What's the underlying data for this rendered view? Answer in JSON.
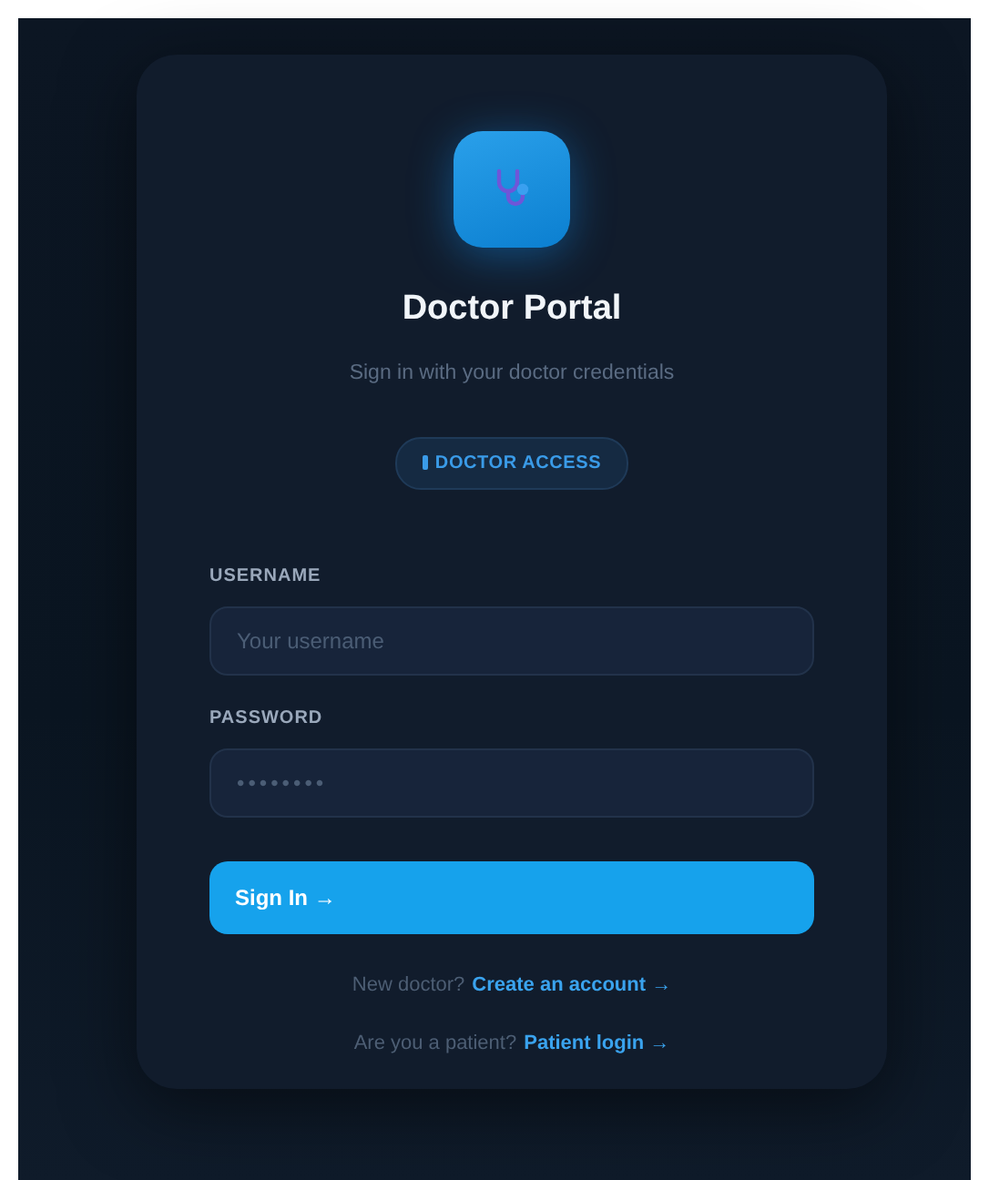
{
  "title": "Doctor Portal",
  "subtitle": "Sign in with your doctor credentials",
  "badge": {
    "label": "DOCTOR ACCESS"
  },
  "fields": [
    {
      "label": "USERNAME",
      "placeholder": "Your username"
    },
    {
      "label": "PASSWORD",
      "placeholder": "••••••••",
      "kind": "password"
    }
  ],
  "submit": {
    "label": "Sign In →"
  },
  "links": [
    {
      "prompt": "New doctor?",
      "link": "Create an account →"
    },
    {
      "prompt": "Are you a patient?",
      "link": "Patient login →"
    }
  ]
}
